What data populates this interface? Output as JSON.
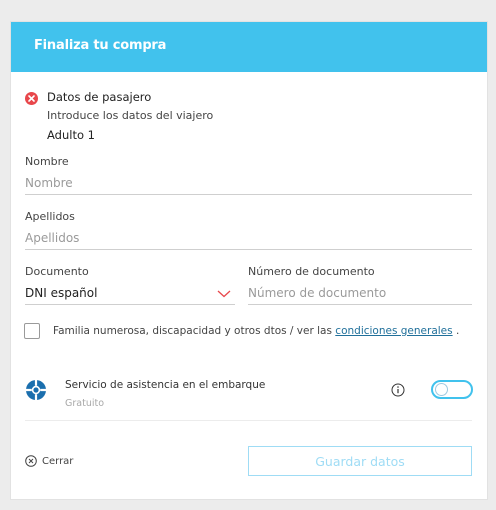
{
  "header": {
    "title": "Finaliza tu compra"
  },
  "passenger": {
    "section_title": "Datos de pasajero",
    "subtitle": "Introduce los datos del viajero",
    "type": "Adulto 1"
  },
  "form": {
    "name": {
      "label": "Nombre",
      "placeholder": "Nombre",
      "value": ""
    },
    "surname": {
      "label": "Apellidos",
      "placeholder": "Apellidos",
      "value": ""
    },
    "document": {
      "label": "Documento",
      "selected": "DNI español"
    },
    "document_number": {
      "label": "Número de documento",
      "placeholder": "Número de documento",
      "value": ""
    }
  },
  "discount": {
    "checked": false,
    "text_before": "Familia numerosa, discapacidad y otros dtos / ver las ",
    "link_text": "condiciones generales",
    "text_after": " ."
  },
  "assistance": {
    "title": "Servicio de asistencia en el embarque",
    "subtitle": "Gratuito",
    "enabled": false
  },
  "actions": {
    "close_label": "Cerrar",
    "save_label": "Guardar datos"
  },
  "colors": {
    "header_bg": "#41c2ed",
    "error": "#e8474b",
    "accent": "#41c2ed",
    "assist_icon": "#1b6fae",
    "link": "#1f6f9a",
    "chevron": "#e8474b"
  },
  "icons": {
    "error": "error-circle-icon",
    "assistance": "lifebuoy-icon",
    "info": "info-icon",
    "close": "close-circle-icon",
    "dropdown": "chevron-down-icon"
  }
}
